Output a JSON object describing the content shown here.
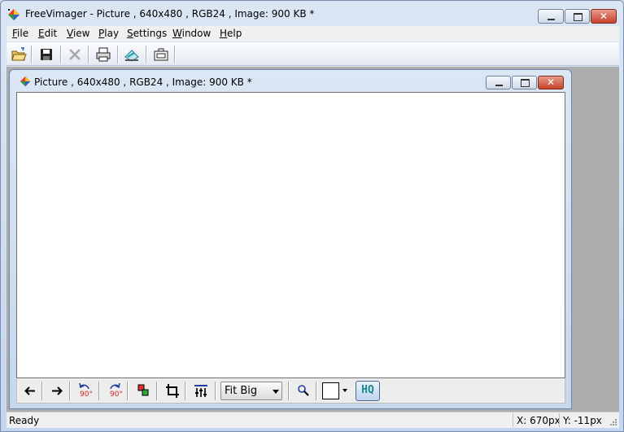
{
  "window": {
    "title": "FreeVimager - Picture , 640x480 , RGB24 , Image: 900 KB *"
  },
  "menu": {
    "items": [
      {
        "key": "F",
        "rest": "ile"
      },
      {
        "key": "E",
        "rest": "dit"
      },
      {
        "key": "V",
        "rest": "iew"
      },
      {
        "key": "P",
        "rest": "lay"
      },
      {
        "key": "S",
        "rest": "ettings"
      },
      {
        "key": "W",
        "rest": "indow"
      },
      {
        "key": "H",
        "rest": "elp"
      }
    ]
  },
  "toolbar": {
    "buttons": [
      "open-folder-icon",
      "save-icon",
      "delete-icon",
      "print-icon",
      "scan-icon",
      "capture-icon"
    ]
  },
  "document": {
    "title": "Picture , 640x480 , RGB24 , Image: 900 KB *",
    "canvas_color": "#ffffff"
  },
  "view_toolbar": {
    "rotate_ccw_label": "90°",
    "rotate_cw_label": "90°",
    "zoom_value": "Fit Big",
    "hq_label": "HQ",
    "background_color": "#ffffff"
  },
  "status": {
    "text": "Ready",
    "x": "X: 670px",
    "y": "Y: -11px"
  },
  "colors": {
    "mdi_background": "#acacac",
    "close_button": "#c5412a"
  }
}
